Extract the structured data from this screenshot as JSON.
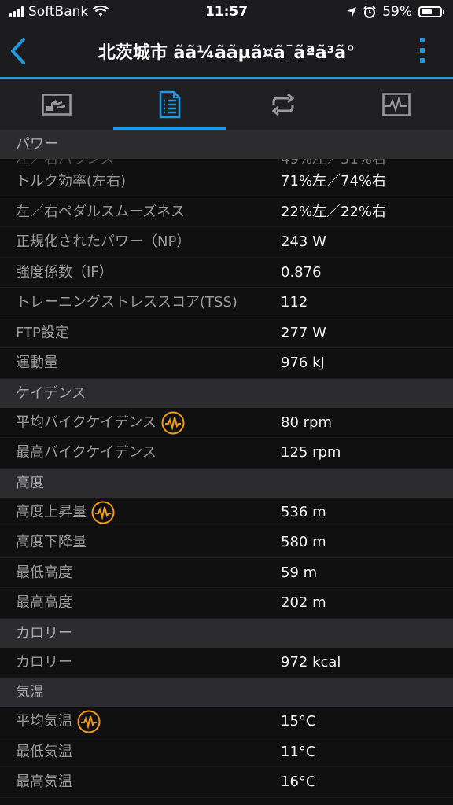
{
  "status_bar": {
    "carrier": "SoftBank",
    "time": "11:57",
    "battery": "59%",
    "battery_level": 0.59
  },
  "nav": {
    "title": "北茨城市 ãã¼ããµã¤ã¯ãªã³ã°"
  },
  "tabs": [
    {
      "icon": "chart-tab-icon",
      "active": false
    },
    {
      "icon": "document-tab-icon",
      "active": true
    },
    {
      "icon": "repeat-tab-icon",
      "active": false
    },
    {
      "icon": "graph-tab-icon",
      "active": false
    }
  ],
  "sections": {
    "power": {
      "header": "パワー",
      "rows": [
        {
          "label": "トルク効率(左右)",
          "value": "71%左／74%右"
        },
        {
          "label": "左／右ペダルスムーズネス",
          "value": "22%左／22%右"
        },
        {
          "label": "正規化されたパワー（NP）",
          "value": "243 W"
        },
        {
          "label": "強度係数（IF）",
          "value": "0.876"
        },
        {
          "label": "トレーニングストレススコア(TSS)",
          "value": "112"
        },
        {
          "label": "FTP設定",
          "value": "277 W"
        },
        {
          "label": "運動量",
          "value": "976 kJ"
        }
      ]
    },
    "cadence": {
      "header": "ケイデンス",
      "rows": [
        {
          "label": "平均バイクケイデンス",
          "value": "80 rpm"
        },
        {
          "label": "最高バイクケイデンス",
          "value": "125 rpm"
        }
      ]
    },
    "elevation": {
      "header": "高度",
      "rows": [
        {
          "label": "高度上昇量",
          "value": "536 m"
        },
        {
          "label": "高度下降量",
          "value": "580 m"
        },
        {
          "label": "最低高度",
          "value": "59 m"
        },
        {
          "label": "最高高度",
          "value": "202 m"
        }
      ]
    },
    "calories": {
      "header": "カロリー",
      "rows": [
        {
          "label": "カロリー",
          "value": "972 kcal"
        }
      ]
    },
    "temperature": {
      "header": "気温",
      "rows": [
        {
          "label": "平均気温",
          "value": "15°C"
        },
        {
          "label": "最低気温",
          "value": "11°C"
        },
        {
          "label": "最高気温",
          "value": "16°C"
        }
      ]
    }
  },
  "colors": {
    "accent": "#1e9be0",
    "pulse_icon": "#f39c12"
  }
}
